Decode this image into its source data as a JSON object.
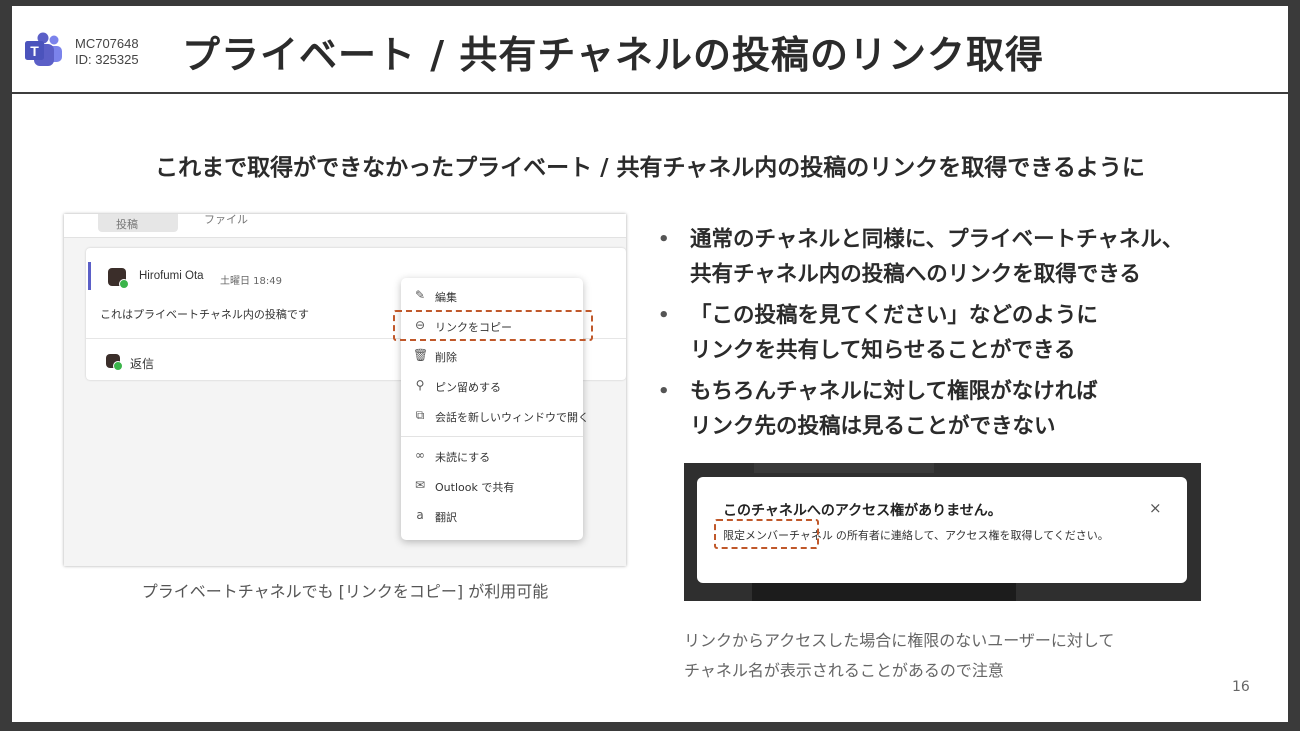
{
  "header": {
    "mc_number": "MC707648",
    "id_label": "ID: 325325",
    "title": "プライベート / 共有チャネルの投稿のリンク取得"
  },
  "subtitle": "これまで取得ができなかったプライベート / 共有チャネル内の投稿のリンクを取得できるように",
  "left_screenshot": {
    "tabs": [
      "投稿",
      "ファイル"
    ],
    "post": {
      "author": "Hirofumi Ota",
      "time": "土曜日 18:49",
      "text": "これはプライベートチャネル内の投稿です",
      "reply_label": "返信"
    },
    "context_menu": [
      {
        "icon": "edit-icon",
        "label": "編集"
      },
      {
        "icon": "link-icon",
        "label": "リンクをコピー"
      },
      {
        "icon": "trash-icon",
        "label": "削除"
      },
      {
        "icon": "pin-icon",
        "label": "ピン留めする"
      },
      {
        "icon": "popout-icon",
        "label": "会話を新しいウィンドウで開く"
      },
      {
        "icon": "unread-icon",
        "label": "未読にする"
      },
      {
        "icon": "mail-icon",
        "label": "Outlook で共有"
      },
      {
        "icon": "translate-icon",
        "label": "翻訳"
      }
    ],
    "caption": "プライベートチャネルでも [リンクをコピー] が利用可能"
  },
  "bullets": [
    {
      "lines": [
        "通常のチャネルと同様に、プライベートチャネル、",
        "共有チャネル内の投稿へのリンクを取得できる"
      ]
    },
    {
      "lines": [
        "「この投稿を見てください」などのように",
        "リンクを共有して知らせることができる"
      ]
    },
    {
      "lines": [
        "もちろんチャネルに対して権限がなければ",
        "リンク先の投稿は見ることができない"
      ]
    }
  ],
  "right_screenshot": {
    "dialog_title": "このチャネルへのアクセス権がありません。",
    "dialog_channel": "限定メンバーチャネル",
    "dialog_body": "の所有者に連絡して、アクセス権を取得してください。",
    "close_symbol": "×",
    "caption_lines": [
      "リンクからアクセスした場合に権限のないユーザーに対して",
      "チャネル名が表示されることがあるので注意"
    ]
  },
  "page_number": "16",
  "colors": {
    "highlight": "#c0582a",
    "teams_purple": "#5b5fc7",
    "presence_green": "#3bb44a"
  }
}
